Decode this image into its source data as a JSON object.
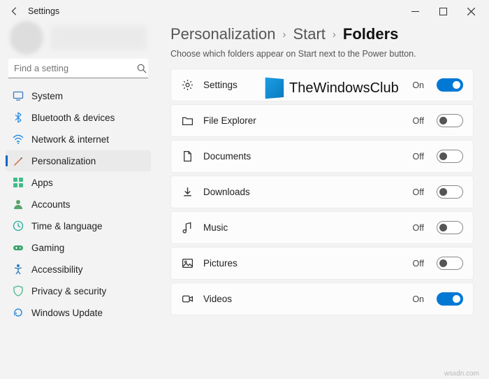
{
  "window": {
    "title": "Settings"
  },
  "search": {
    "placeholder": "Find a setting"
  },
  "sidebar": {
    "items": [
      {
        "label": "System"
      },
      {
        "label": "Bluetooth & devices"
      },
      {
        "label": "Network & internet"
      },
      {
        "label": "Personalization"
      },
      {
        "label": "Apps"
      },
      {
        "label": "Accounts"
      },
      {
        "label": "Time & language"
      },
      {
        "label": "Gaming"
      },
      {
        "label": "Accessibility"
      },
      {
        "label": "Privacy & security"
      },
      {
        "label": "Windows Update"
      }
    ]
  },
  "breadcrumb": {
    "a": "Personalization",
    "b": "Start",
    "c": "Folders"
  },
  "description": "Choose which folders appear on Start next to the Power button.",
  "toggle_labels": {
    "on": "On",
    "off": "Off"
  },
  "rows": [
    {
      "label": "Settings",
      "state": "On"
    },
    {
      "label": "File Explorer",
      "state": "Off"
    },
    {
      "label": "Documents",
      "state": "Off"
    },
    {
      "label": "Downloads",
      "state": "Off"
    },
    {
      "label": "Music",
      "state": "Off"
    },
    {
      "label": "Pictures",
      "state": "Off"
    },
    {
      "label": "Videos",
      "state": "On"
    }
  ],
  "watermark": {
    "text": "TheWindowsClub"
  },
  "footer": "wsxdn.com"
}
